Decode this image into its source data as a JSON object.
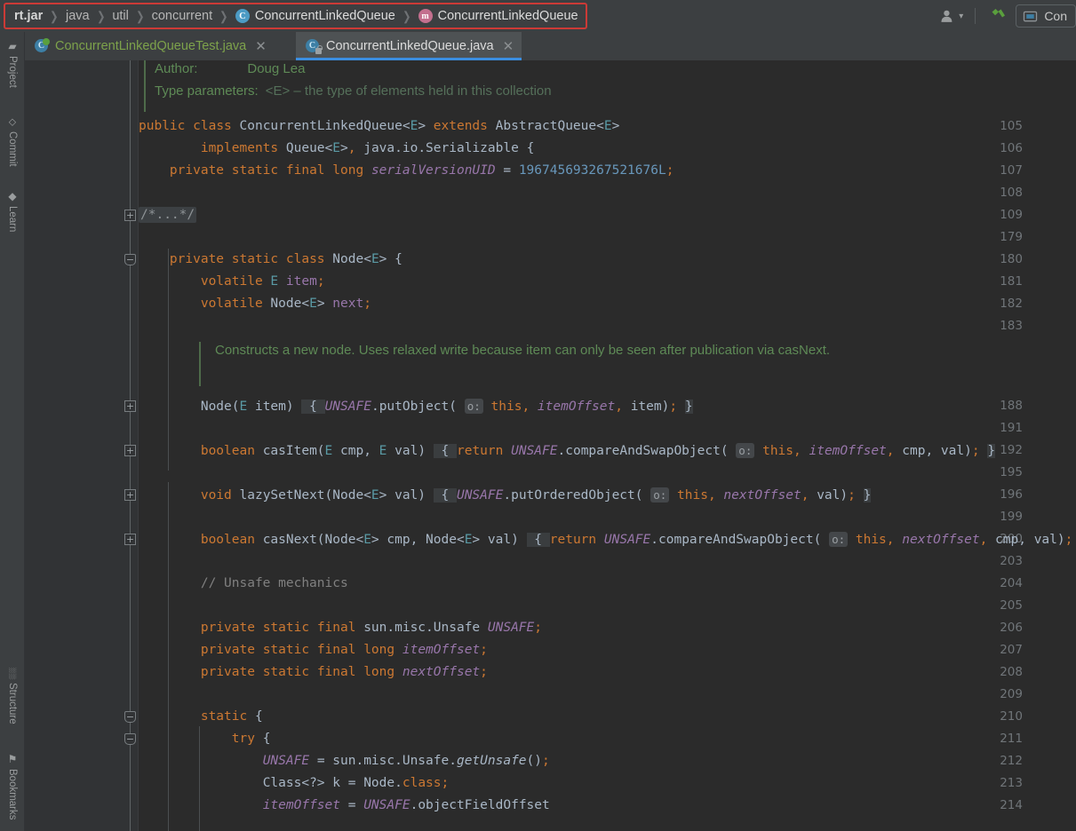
{
  "window": {
    "title": "ConcurrentLinkedQueue.java"
  },
  "breadcrumb": {
    "name": "navigation-breadcrumb",
    "items": [
      {
        "label": "rt.jar",
        "style": "bold",
        "icon": ""
      },
      {
        "label": "java",
        "style": "dim",
        "icon": ""
      },
      {
        "label": "util",
        "style": "dim",
        "icon": ""
      },
      {
        "label": "concurrent",
        "style": "dim",
        "icon": ""
      },
      {
        "label": "ConcurrentLinkedQueue",
        "style": "lit",
        "icon": "class-icon",
        "icon_glyph": "C"
      },
      {
        "label": "ConcurrentLinkedQueue",
        "style": "lit",
        "icon": "method-icon",
        "icon_glyph": "m"
      }
    ],
    "separator": "❯",
    "highlight_color": "#cc3a36"
  },
  "toolbar": {
    "account_icon": "user-account-icon",
    "account_dropdown": "▾",
    "build_icon": "build-hammer-icon",
    "build_color": "#5a9f3d",
    "run_config": {
      "icon": "run-configuration-icon",
      "label": "Con"
    }
  },
  "stripe": {
    "top": [
      {
        "label": "Project",
        "icon": "project-folder-icon",
        "glyph": "▰"
      },
      {
        "label": "Commit",
        "icon": "commit-icon",
        "glyph": "⬦"
      },
      {
        "label": "Learn",
        "icon": "learn-graduation-icon",
        "glyph": "◆"
      }
    ],
    "bottom": [
      {
        "label": "Structure",
        "icon": "structure-icon",
        "glyph": "░"
      },
      {
        "label": "Bookmarks",
        "icon": "bookmark-icon",
        "glyph": "⚑"
      }
    ]
  },
  "tabs": [
    {
      "label": "ConcurrentLinkedQueueTest.java",
      "active": false,
      "icon": "java-test-class-icon",
      "glyph": "C",
      "close": "✕"
    },
    {
      "label": "ConcurrentLinkedQueue.java",
      "active": true,
      "icon": "java-class-readonly-icon",
      "glyph": "C",
      "close": "✕"
    }
  ],
  "editor": {
    "javadoc_header": {
      "author_label": "Author:",
      "author_value": "Doug Lea",
      "typeparams_label": "Type parameters:",
      "typeparams_value": "<E> – the type of elements held in this collection"
    },
    "javadoc_block": {
      "text": "Constructs a new node. Uses relaxed write because item can only be seen after publication via casNext."
    },
    "fold_placeholder": "/*...*/",
    "inlay_hint": "o:",
    "line_numbers": [
      105,
      106,
      107,
      108,
      109,
      179,
      180,
      181,
      182,
      183,
      188,
      191,
      192,
      195,
      196,
      199,
      200,
      203,
      204,
      205,
      206,
      207,
      208,
      209,
      210,
      211,
      212,
      213,
      214
    ],
    "fold_markers": [
      {
        "line": 109,
        "type": "collapsed"
      },
      {
        "line": 180,
        "type": "expanded"
      },
      {
        "line": 188,
        "type": "collapsed"
      },
      {
        "line": 192,
        "type": "collapsed"
      },
      {
        "line": 196,
        "type": "collapsed"
      },
      {
        "line": 200,
        "type": "collapsed"
      },
      {
        "line": 210,
        "type": "expanded"
      },
      {
        "line": 211,
        "type": "expanded"
      }
    ],
    "code_lines": [
      {
        "line": 105,
        "text": "public class ConcurrentLinkedQueue<E> extends AbstractQueue<E>"
      },
      {
        "line": 106,
        "text": "        implements Queue<E>, java.io.Serializable {"
      },
      {
        "line": 107,
        "text": "    private static final long serialVersionUID = 196745693267521676L;"
      },
      {
        "line": 108,
        "text": ""
      },
      {
        "line": 109,
        "text": "/*...*/"
      },
      {
        "line": 179,
        "text": ""
      },
      {
        "line": 180,
        "text": "    private static class Node<E> {"
      },
      {
        "line": 181,
        "text": "        volatile E item;"
      },
      {
        "line": 182,
        "text": "        volatile Node<E> next;"
      },
      {
        "line": 183,
        "text": ""
      },
      {
        "line": 188,
        "text": "        Node(E item) { UNSAFE.putObject( o: this, itemOffset, item); }"
      },
      {
        "line": 191,
        "text": ""
      },
      {
        "line": 192,
        "text": "        boolean casItem(E cmp, E val) { return UNSAFE.compareAndSwapObject( o: this, itemOffset, cmp, val); }"
      },
      {
        "line": 195,
        "text": ""
      },
      {
        "line": 196,
        "text": "        void lazySetNext(Node<E> val) { UNSAFE.putOrderedObject( o: this, nextOffset, val); }"
      },
      {
        "line": 199,
        "text": ""
      },
      {
        "line": 200,
        "text": "        boolean casNext(Node<E> cmp, Node<E> val) { return UNSAFE.compareAndSwapObject( o: this, nextOffset, cmp, val); }"
      },
      {
        "line": 203,
        "text": ""
      },
      {
        "line": 204,
        "text": "        // Unsafe mechanics"
      },
      {
        "line": 205,
        "text": ""
      },
      {
        "line": 206,
        "text": "        private static final sun.misc.Unsafe UNSAFE;"
      },
      {
        "line": 207,
        "text": "        private static final long itemOffset;"
      },
      {
        "line": 208,
        "text": "        private static final long nextOffset;"
      },
      {
        "line": 209,
        "text": ""
      },
      {
        "line": 210,
        "text": "        static {"
      },
      {
        "line": 211,
        "text": "            try {"
      },
      {
        "line": 212,
        "text": "                UNSAFE = sun.misc.Unsafe.getUnsafe();"
      },
      {
        "line": 213,
        "text": "                Class<?> k = Node.class;"
      },
      {
        "line": 214,
        "text": "                itemOffset = UNSAFE.objectFieldOffset"
      }
    ]
  },
  "colors": {
    "editor_background": "#2b2b2b",
    "gutter_background": "#313335",
    "chrome_background": "#3c3f41",
    "keyword": "#cc7832",
    "identifier": "#a9b7c6",
    "generic": "#5a9aa5",
    "field": "#9876aa",
    "number": "#6897bb",
    "comment": "#808080",
    "javadoc": "#5e8a56",
    "active_tab_underline": "#3b8ee0"
  }
}
